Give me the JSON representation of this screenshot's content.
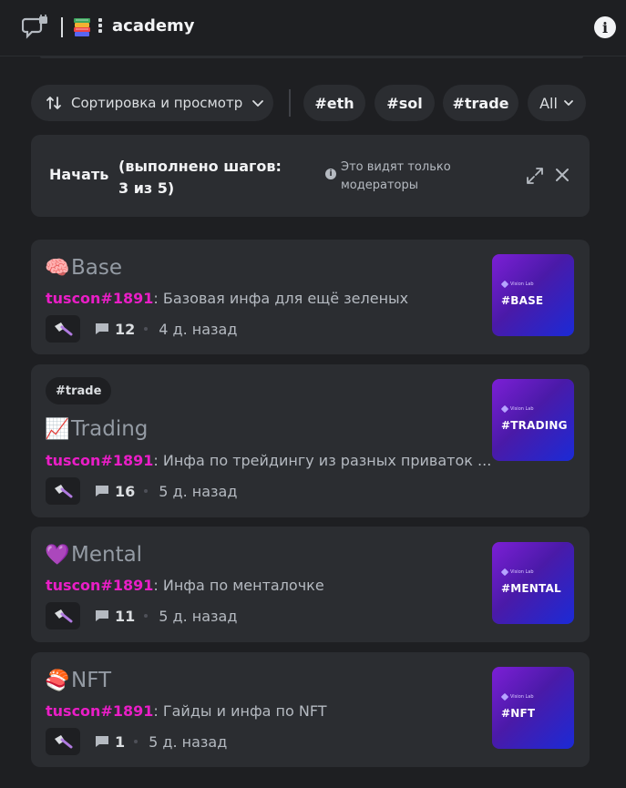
{
  "header": {
    "title": "academy",
    "icon_channel": "forum-lock-icon",
    "icon_books": "books-icon",
    "info_label": "i"
  },
  "filters": {
    "sort_label": "Сортировка и просмотр",
    "tags": [
      "#eth",
      "#sol",
      "#trade"
    ],
    "all_label": "All"
  },
  "onboarding": {
    "start_label": "Начать",
    "progress_text": "(выполнено шагов: 3 из 5)",
    "note": "Это видят только модераторы"
  },
  "posts": [
    {
      "emoji": "🧠",
      "title": "Base",
      "tag": "",
      "author": "tuscon#1891",
      "preview": "Базовая инфа для ещё зеленых",
      "comments": "12",
      "ago": "4 д. назад",
      "thumb_brand": "Vision Lab",
      "thumb_text": "#BASE"
    },
    {
      "emoji": "📈",
      "title": "Trading",
      "tag": "#trade",
      "author": "tuscon#1891",
      "preview": "Инфа по трейдингу из разных приваток ...",
      "comments": "16",
      "ago": "5 д. назад",
      "thumb_brand": "Vision Lab",
      "thumb_text": "#TRADING"
    },
    {
      "emoji": "💜",
      "title": "Mental",
      "tag": "",
      "author": "tuscon#1891",
      "preview": "Инфа по менталочке",
      "comments": "11",
      "ago": "5 д. назад",
      "thumb_brand": "Vision Lab",
      "thumb_text": "#MENTAL"
    },
    {
      "emoji": "🍣",
      "title": "NFT",
      "tag": "",
      "author": "tuscon#1891",
      "preview": "Гайды и инфа по NFT",
      "comments": "1",
      "ago": "5 д. назад",
      "thumb_brand": "Vision Lab",
      "thumb_text": "#NFT"
    }
  ],
  "colors": {
    "background": "#1e1f22",
    "card": "#2b2d31",
    "author": "#e91ec6",
    "muted": "#949ba4"
  }
}
